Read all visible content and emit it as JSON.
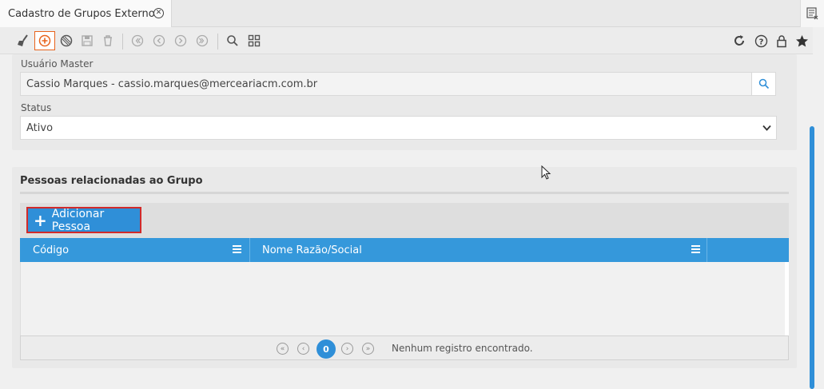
{
  "tab": {
    "title": "Cadastro de Grupos Externo"
  },
  "toolbar": {
    "left_icons": [
      "broom-icon",
      "add-icon",
      "cancel-icon",
      "save-icon",
      "delete-icon",
      "first-icon",
      "prev-icon",
      "next-icon",
      "last-icon",
      "search-icon",
      "grid-icon"
    ],
    "right_icons": [
      "refresh-icon",
      "help-icon",
      "lock-icon",
      "star-icon"
    ],
    "accent": "#e8631c"
  },
  "form": {
    "master_label": "Usuário Master",
    "master_value": "Cassio Marques - cassio.marques@merceariacm.com.br",
    "status_label": "Status",
    "status_value": "Ativo"
  },
  "people": {
    "title": "Pessoas relacionadas ao Grupo",
    "add_button": "Adicionar Pessoa",
    "columns": [
      "Código",
      "Nome Razão/Social"
    ],
    "rows": [],
    "pager": {
      "current_page": "0",
      "message": "Nenhum registro encontrado."
    }
  },
  "colors": {
    "primary": "#3598db",
    "highlight_border": "#d12a2a"
  }
}
